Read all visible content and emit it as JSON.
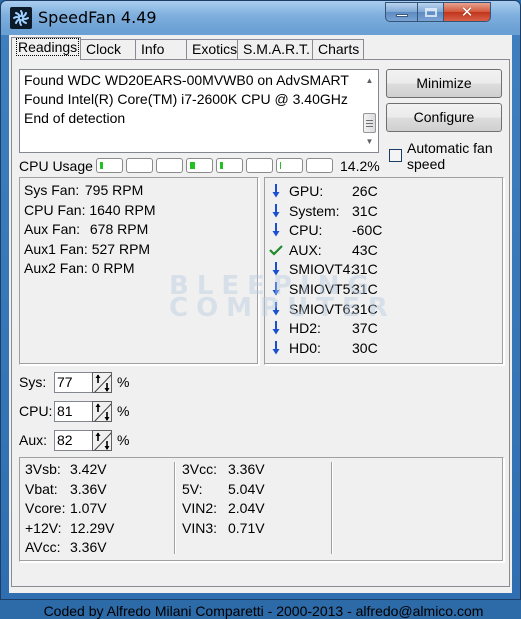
{
  "window": {
    "title": "SpeedFan 4.49",
    "icon": "fan-icon",
    "controls": {
      "minimize": "minimize-icon",
      "maximize": "maximize-icon",
      "close": "close-icon"
    }
  },
  "tabs": [
    {
      "label": "Readings",
      "active": true
    },
    {
      "label": "Clock",
      "active": false
    },
    {
      "label": "Info",
      "active": false
    },
    {
      "label": "Exotics",
      "active": false
    },
    {
      "label": "S.M.A.R.T.",
      "active": false
    },
    {
      "label": "Charts",
      "active": false
    }
  ],
  "log": {
    "lines": [
      "Found WDC WD20EARS-00MVWB0 on AdvSMART",
      "Found Intel(R) Core(TM) i7-2600K CPU @ 3.40GHz",
      "End of detection"
    ]
  },
  "buttons": {
    "minimize": "Minimize",
    "configure": "Configure"
  },
  "auto_fan": {
    "label": "Automatic fan speed",
    "checked": false
  },
  "cpu_usage": {
    "label": "CPU Usage",
    "percent_text": "14.2%",
    "cores": [
      0.12,
      0.0,
      0.0,
      0.25,
      0.15,
      0.0,
      0.05,
      0.0
    ]
  },
  "fans": [
    {
      "label": "Sys Fan:",
      "value": "795 RPM"
    },
    {
      "label": "CPU Fan:",
      "value": "1640 RPM"
    },
    {
      "label": "Aux Fan:",
      "value": "678 RPM"
    },
    {
      "label": "Aux1 Fan:",
      "value": "527 RPM"
    },
    {
      "label": "Aux2 Fan:",
      "value": "0 RPM"
    }
  ],
  "temps": [
    {
      "name": "GPU:",
      "value": "26C",
      "status": "down",
      "icon": "arrow-down-icon"
    },
    {
      "name": "System:",
      "value": "31C",
      "status": "down",
      "icon": "arrow-down-icon"
    },
    {
      "name": "CPU:",
      "value": "-60C",
      "status": "down",
      "icon": "arrow-down-icon"
    },
    {
      "name": "AUX:",
      "value": "43C",
      "status": "ok",
      "icon": "checkmark-icon"
    },
    {
      "name": "SMIOVT4:",
      "value": "31C",
      "status": "down",
      "icon": "arrow-down-icon"
    },
    {
      "name": "SMIOVT5:",
      "value": "31C",
      "status": "down",
      "icon": "arrow-down-icon"
    },
    {
      "name": "SMIOVT6:",
      "value": "31C",
      "status": "down",
      "icon": "arrow-down-icon"
    },
    {
      "name": "HD2:",
      "value": "37C",
      "status": "down",
      "icon": "arrow-down-icon"
    },
    {
      "name": "HD0:",
      "value": "30C",
      "status": "down",
      "icon": "arrow-down-icon"
    }
  ],
  "watermark": [
    "BLEEPING",
    "COMPUTER"
  ],
  "speeds": [
    {
      "label": "Sys:",
      "value": "77",
      "unit": "%"
    },
    {
      "label": "CPU:",
      "value": "81",
      "unit": "%"
    },
    {
      "label": "Aux:",
      "value": "82",
      "unit": "%"
    }
  ],
  "voltages": {
    "col1": [
      {
        "label": "3Vsb:",
        "value": "3.42V"
      },
      {
        "label": "Vbat:",
        "value": "3.36V"
      },
      {
        "label": "Vcore:",
        "value": "1.07V"
      },
      {
        "label": "+12V:",
        "value": "12.29V"
      },
      {
        "label": "AVcc:",
        "value": "3.36V"
      }
    ],
    "col2": [
      {
        "label": "3Vcc:",
        "value": "3.36V"
      },
      {
        "label": "5V:",
        "value": "5.04V"
      },
      {
        "label": "VIN2:",
        "value": "2.04V"
      },
      {
        "label": "VIN3:",
        "value": "0.71V"
      }
    ]
  },
  "colors": {
    "arrow_down": "#1a4fd0",
    "check_ok": "#1e8a2a",
    "meter_fill": "#22c022"
  },
  "footer": "Coded by Alfredo Milani Comparetti - 2000-2013 - alfredo@almico.com"
}
